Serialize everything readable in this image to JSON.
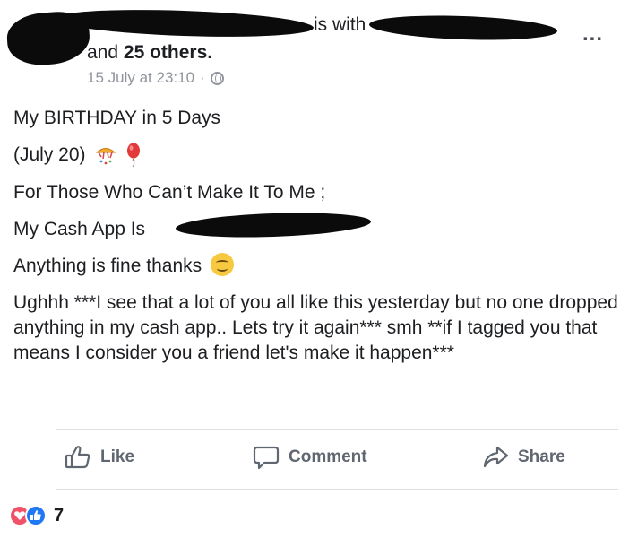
{
  "header": {
    "is_with": "is with",
    "others_count": "25 others.",
    "and_text": "and",
    "timestamp": "15 July at 23:10",
    "separator": "·",
    "more_label": "..."
  },
  "post": {
    "lines": [
      "My BIRTHDAY in 5 Days",
      "(July 20)",
      "For Those Who Can’t Make It To Me ;",
      "My Cash App Is",
      "Anything is fine thanks",
      "Ughhh ***I see that a lot of you all like this yesterday but no one dropped anything in my cash app.. Lets try it again*** smh **if I tagged you that means I consider you a friend let's make it happen***"
    ]
  },
  "actions": {
    "like": "Like",
    "comment": "Comment",
    "share": "Share"
  },
  "reactions": {
    "count": "7"
  },
  "colors": {
    "text": "#1c1e21",
    "meta": "#90949c",
    "action": "#606770",
    "love": "#f25268",
    "like": "#2078f4"
  }
}
